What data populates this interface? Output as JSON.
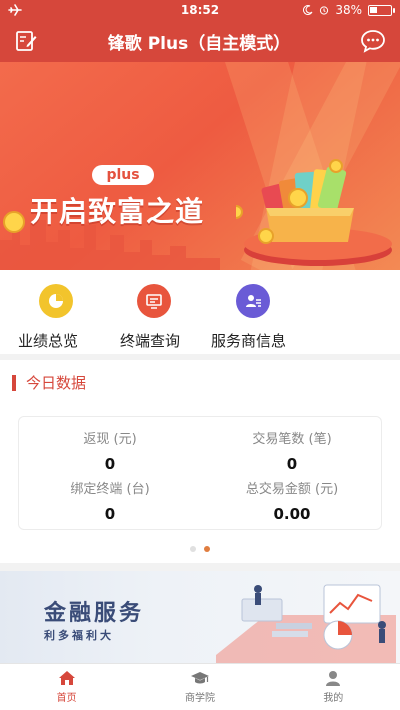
{
  "status_bar": {
    "time": "18:52",
    "battery": "38%",
    "battery_level": 0.38
  },
  "header": {
    "title": "锋歌 Plus（自主模式）"
  },
  "banner": {
    "tag": "plus",
    "title": "开启致富之道"
  },
  "quick_menu": [
    {
      "label": "业绩总览",
      "icon": "pie-chart-icon",
      "color": "#f2c42c"
    },
    {
      "label": "终端查询",
      "icon": "terminal-device-icon",
      "color": "#e8553d"
    },
    {
      "label": "服务商信息",
      "icon": "user-info-icon",
      "color": "#6a5bd6"
    }
  ],
  "today": {
    "title": "今日数据",
    "stats": [
      {
        "label": "返现 (元)",
        "value": "0"
      },
      {
        "label": "交易笔数 (笔)",
        "value": "0"
      },
      {
        "label": "绑定终端 (台)",
        "value": "0"
      },
      {
        "label": "总交易金额 (元)",
        "value": "0.00"
      }
    ],
    "pager_active": 2
  },
  "finance": {
    "title": "金融服务",
    "subtitle": "利多福利大"
  },
  "tabbar": [
    {
      "label": "首页",
      "icon": "home-icon",
      "active": true
    },
    {
      "label": "商学院",
      "icon": "graduation-cap-icon",
      "active": false
    },
    {
      "label": "我的",
      "icon": "profile-icon",
      "active": false
    }
  ],
  "colors": {
    "brand": "#d6473b",
    "accent": "#e07d3f"
  }
}
